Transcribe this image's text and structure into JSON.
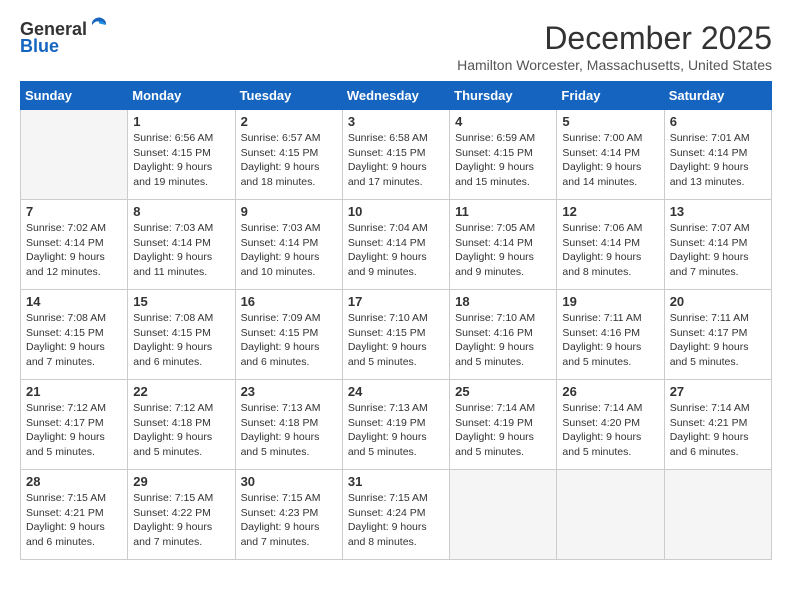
{
  "logo": {
    "line1": "General",
    "line2": "Blue"
  },
  "title": "December 2025",
  "location": "Hamilton Worcester, Massachusetts, United States",
  "days_of_week": [
    "Sunday",
    "Monday",
    "Tuesday",
    "Wednesday",
    "Thursday",
    "Friday",
    "Saturday"
  ],
  "weeks": [
    [
      {
        "day": "",
        "info": ""
      },
      {
        "day": "1",
        "info": "Sunrise: 6:56 AM\nSunset: 4:15 PM\nDaylight: 9 hours\nand 19 minutes."
      },
      {
        "day": "2",
        "info": "Sunrise: 6:57 AM\nSunset: 4:15 PM\nDaylight: 9 hours\nand 18 minutes."
      },
      {
        "day": "3",
        "info": "Sunrise: 6:58 AM\nSunset: 4:15 PM\nDaylight: 9 hours\nand 17 minutes."
      },
      {
        "day": "4",
        "info": "Sunrise: 6:59 AM\nSunset: 4:15 PM\nDaylight: 9 hours\nand 15 minutes."
      },
      {
        "day": "5",
        "info": "Sunrise: 7:00 AM\nSunset: 4:14 PM\nDaylight: 9 hours\nand 14 minutes."
      },
      {
        "day": "6",
        "info": "Sunrise: 7:01 AM\nSunset: 4:14 PM\nDaylight: 9 hours\nand 13 minutes."
      }
    ],
    [
      {
        "day": "7",
        "info": "Sunrise: 7:02 AM\nSunset: 4:14 PM\nDaylight: 9 hours\nand 12 minutes."
      },
      {
        "day": "8",
        "info": "Sunrise: 7:03 AM\nSunset: 4:14 PM\nDaylight: 9 hours\nand 11 minutes."
      },
      {
        "day": "9",
        "info": "Sunrise: 7:03 AM\nSunset: 4:14 PM\nDaylight: 9 hours\nand 10 minutes."
      },
      {
        "day": "10",
        "info": "Sunrise: 7:04 AM\nSunset: 4:14 PM\nDaylight: 9 hours\nand 9 minutes."
      },
      {
        "day": "11",
        "info": "Sunrise: 7:05 AM\nSunset: 4:14 PM\nDaylight: 9 hours\nand 9 minutes."
      },
      {
        "day": "12",
        "info": "Sunrise: 7:06 AM\nSunset: 4:14 PM\nDaylight: 9 hours\nand 8 minutes."
      },
      {
        "day": "13",
        "info": "Sunrise: 7:07 AM\nSunset: 4:14 PM\nDaylight: 9 hours\nand 7 minutes."
      }
    ],
    [
      {
        "day": "14",
        "info": "Sunrise: 7:08 AM\nSunset: 4:15 PM\nDaylight: 9 hours\nand 7 minutes."
      },
      {
        "day": "15",
        "info": "Sunrise: 7:08 AM\nSunset: 4:15 PM\nDaylight: 9 hours\nand 6 minutes."
      },
      {
        "day": "16",
        "info": "Sunrise: 7:09 AM\nSunset: 4:15 PM\nDaylight: 9 hours\nand 6 minutes."
      },
      {
        "day": "17",
        "info": "Sunrise: 7:10 AM\nSunset: 4:15 PM\nDaylight: 9 hours\nand 5 minutes."
      },
      {
        "day": "18",
        "info": "Sunrise: 7:10 AM\nSunset: 4:16 PM\nDaylight: 9 hours\nand 5 minutes."
      },
      {
        "day": "19",
        "info": "Sunrise: 7:11 AM\nSunset: 4:16 PM\nDaylight: 9 hours\nand 5 minutes."
      },
      {
        "day": "20",
        "info": "Sunrise: 7:11 AM\nSunset: 4:17 PM\nDaylight: 9 hours\nand 5 minutes."
      }
    ],
    [
      {
        "day": "21",
        "info": "Sunrise: 7:12 AM\nSunset: 4:17 PM\nDaylight: 9 hours\nand 5 minutes."
      },
      {
        "day": "22",
        "info": "Sunrise: 7:12 AM\nSunset: 4:18 PM\nDaylight: 9 hours\nand 5 minutes."
      },
      {
        "day": "23",
        "info": "Sunrise: 7:13 AM\nSunset: 4:18 PM\nDaylight: 9 hours\nand 5 minutes."
      },
      {
        "day": "24",
        "info": "Sunrise: 7:13 AM\nSunset: 4:19 PM\nDaylight: 9 hours\nand 5 minutes."
      },
      {
        "day": "25",
        "info": "Sunrise: 7:14 AM\nSunset: 4:19 PM\nDaylight: 9 hours\nand 5 minutes."
      },
      {
        "day": "26",
        "info": "Sunrise: 7:14 AM\nSunset: 4:20 PM\nDaylight: 9 hours\nand 5 minutes."
      },
      {
        "day": "27",
        "info": "Sunrise: 7:14 AM\nSunset: 4:21 PM\nDaylight: 9 hours\nand 6 minutes."
      }
    ],
    [
      {
        "day": "28",
        "info": "Sunrise: 7:15 AM\nSunset: 4:21 PM\nDaylight: 9 hours\nand 6 minutes."
      },
      {
        "day": "29",
        "info": "Sunrise: 7:15 AM\nSunset: 4:22 PM\nDaylight: 9 hours\nand 7 minutes."
      },
      {
        "day": "30",
        "info": "Sunrise: 7:15 AM\nSunset: 4:23 PM\nDaylight: 9 hours\nand 7 minutes."
      },
      {
        "day": "31",
        "info": "Sunrise: 7:15 AM\nSunset: 4:24 PM\nDaylight: 9 hours\nand 8 minutes."
      },
      {
        "day": "",
        "info": ""
      },
      {
        "day": "",
        "info": ""
      },
      {
        "day": "",
        "info": ""
      }
    ]
  ]
}
